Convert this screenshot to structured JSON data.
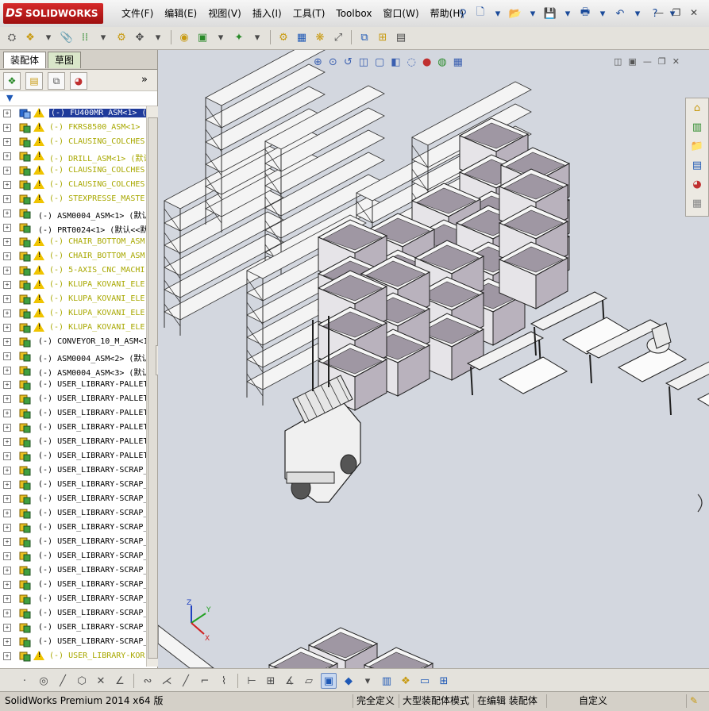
{
  "app": {
    "logo_ds": "DS",
    "logo_text": "SOLIDWORKS"
  },
  "menu": [
    "文件(F)",
    "编辑(E)",
    "视图(V)",
    "插入(I)",
    "工具(T)",
    "Toolbox",
    "窗口(W)",
    "帮助(H)"
  ],
  "panel": {
    "tabs": [
      "装配体",
      "草图"
    ],
    "expand_glyph": "»",
    "tree": [
      {
        "label": "(-) FU400MR_ASM<1> (",
        "warn": true,
        "selected": true
      },
      {
        "label": "(-) FKRS8500_ASM<1>",
        "warn": true
      },
      {
        "label": "(-) CLAUSING_COLCHES",
        "warn": true
      },
      {
        "label": "(-) DRILL_ASM<1> (默认<",
        "warn": true
      },
      {
        "label": "(-) CLAUSING_COLCHES",
        "warn": true
      },
      {
        "label": "(-) CLAUSING_COLCHES",
        "warn": true
      },
      {
        "label": "(-) STEXPRESSE_MASTE",
        "warn": true
      },
      {
        "label": "(-) ASM0004_ASM<1> (默认",
        "warn": false
      },
      {
        "label": "(-) PRT0024<1> (默认<<默",
        "warn": false
      },
      {
        "label": "(-) CHAIR_BOTTOM_ASM",
        "warn": true
      },
      {
        "label": "(-) CHAIR_BOTTOM_ASM",
        "warn": true
      },
      {
        "label": "(-) 5-AXIS_CNC_MACHI",
        "warn": true
      },
      {
        "label": "(-) KLUPA_KOVANI_ELE",
        "warn": true
      },
      {
        "label": "(-) KLUPA_KOVANI_ELE",
        "warn": true
      },
      {
        "label": "(-) KLUPA_KOVANI_ELE",
        "warn": true
      },
      {
        "label": "(-) KLUPA_KOVANI_ELE",
        "warn": true
      },
      {
        "label": "(-) CONVEYOR_10_M_ASM<1",
        "warn": false
      },
      {
        "label": "(-) ASM0004_ASM<2> (默认",
        "warn": false
      },
      {
        "label": "(-) ASM0004_ASM<3> (默认",
        "warn": false
      },
      {
        "label": "(-) USER_LIBRARY-PALLET",
        "warn": false
      },
      {
        "label": "(-) USER_LIBRARY-PALLET",
        "warn": false
      },
      {
        "label": "(-) USER_LIBRARY-PALLET",
        "warn": false
      },
      {
        "label": "(-) USER_LIBRARY-PALLET",
        "warn": false
      },
      {
        "label": "(-) USER_LIBRARY-PALLET",
        "warn": false
      },
      {
        "label": "(-) USER_LIBRARY-PALLET",
        "warn": false
      },
      {
        "label": "(-) USER_LIBRARY-SCRAP_",
        "warn": false
      },
      {
        "label": "(-) USER_LIBRARY-SCRAP_",
        "warn": false
      },
      {
        "label": "(-) USER_LIBRARY-SCRAP_",
        "warn": false
      },
      {
        "label": "(-) USER_LIBRARY-SCRAP_",
        "warn": false
      },
      {
        "label": "(-) USER_LIBRARY-SCRAP_",
        "warn": false
      },
      {
        "label": "(-) USER_LIBRARY-SCRAP_",
        "warn": false
      },
      {
        "label": "(-) USER_LIBRARY-SCRAP_",
        "warn": false
      },
      {
        "label": "(-) USER_LIBRARY-SCRAP_",
        "warn": false
      },
      {
        "label": "(-) USER_LIBRARY-SCRAP_",
        "warn": false
      },
      {
        "label": "(-) USER_LIBRARY-SCRAP_",
        "warn": false
      },
      {
        "label": "(-) USER_LIBRARY-SCRAP_",
        "warn": false
      },
      {
        "label": "(-) USER_LIBRARY-SCRAP_",
        "warn": false
      },
      {
        "label": "(-) USER_LIBRARY-SCRAP_",
        "warn": false
      },
      {
        "label": "(-) USER_LIBRARY-KOR",
        "warn": true
      }
    ]
  },
  "triad": {
    "x": "X",
    "y": "Y",
    "z": "Z"
  },
  "status": {
    "product": "SolidWorks Premium 2014 x64 版",
    "fully_defined": "完全定义",
    "large_assembly": "大型装配体模式",
    "editing": "在编辑 装配体",
    "custom": "自定义"
  },
  "colors": {
    "accent_red": "#b81c1c",
    "selection": "#1f3a9a",
    "warn_text": "#a8a800",
    "viewport_bg": "#d3d7df"
  }
}
